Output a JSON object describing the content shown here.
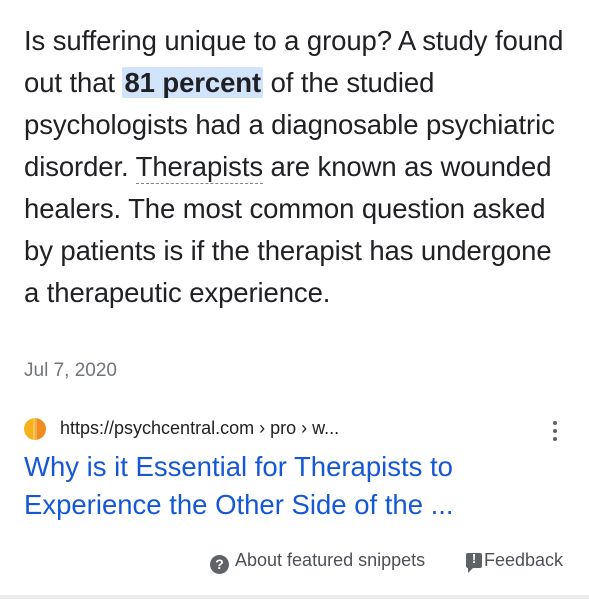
{
  "snippet": {
    "text_before": "Is suffering unique to a group? A study found out that ",
    "highlight": "81 percent",
    "text_middle": " of the studied psychologists had a diagnosable psychiatric disorder. ",
    "dotted_term": "Therapists",
    "text_after": " are known as wounded healers. The most common question asked by patients is if the therapist has undergone a therapeutic experience.",
    "date": "Jul 7, 2020"
  },
  "source": {
    "url": "https://psychcentral.com › pro › w...",
    "favicon": "psychcentral-favicon",
    "menu_icon": "more-vert-icon",
    "title": "Why is it Essential for Therapists to Experience the Other Side of the ..."
  },
  "footer": {
    "about_label": "About featured snippets",
    "about_icon": "help-icon",
    "feedback_label": "Feedback",
    "feedback_icon": "feedback-icon"
  },
  "colors": {
    "highlight_bg": "#d2e3fc",
    "link": "#1558d6",
    "text": "#202124",
    "muted": "#70757a"
  }
}
